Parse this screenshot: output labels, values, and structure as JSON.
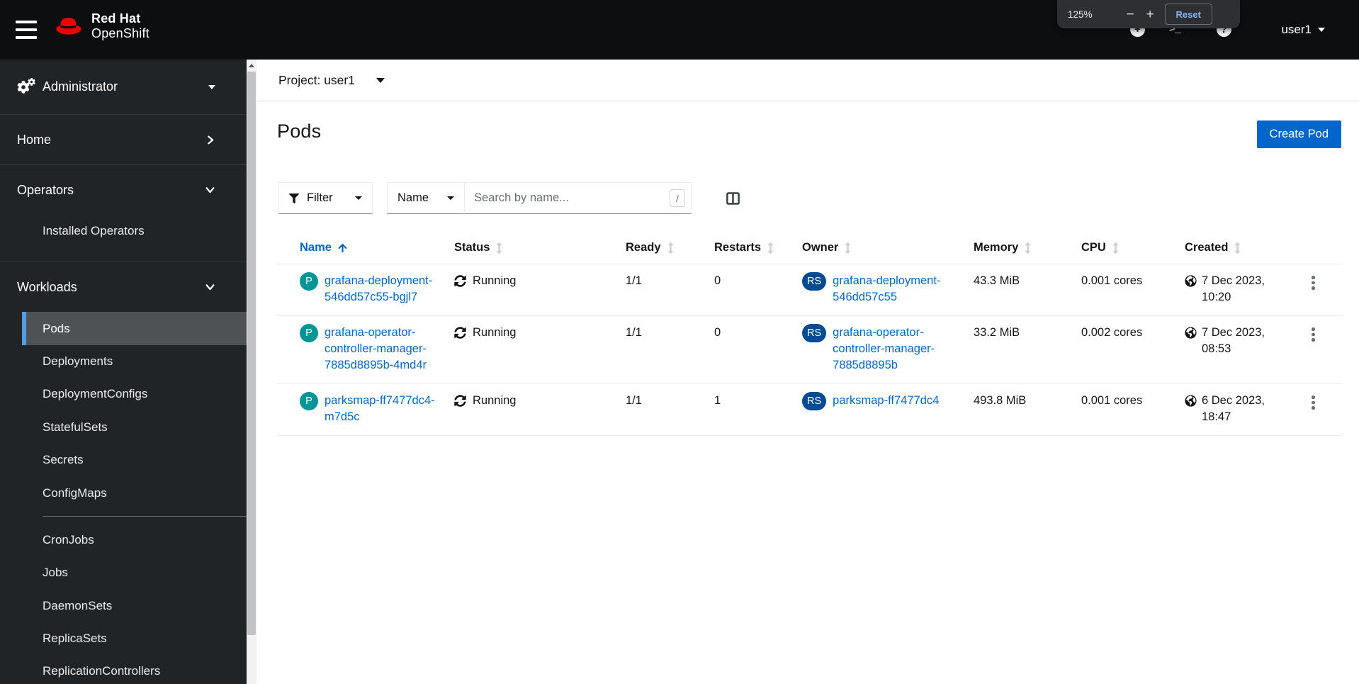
{
  "masthead": {
    "brand": {
      "line1": "Red Hat",
      "line2": "OpenShift"
    },
    "user": {
      "name": "user1"
    }
  },
  "browser_zoom_overlay": {
    "level": "125%",
    "minus_label": "−",
    "plus_label": "+",
    "reset_label": "Reset"
  },
  "sidebar": {
    "perspective": {
      "label": "Administrator"
    },
    "sections": [
      {
        "label": "Home",
        "state": "collapsed",
        "items": []
      },
      {
        "label": "Operators",
        "state": "expanded",
        "items": [
          {
            "label": "Installed Operators"
          }
        ]
      },
      {
        "label": "Workloads",
        "state": "expanded",
        "items": [
          {
            "label": "Pods",
            "active": true
          },
          {
            "label": "Deployments"
          },
          {
            "label": "DeploymentConfigs"
          },
          {
            "label": "StatefulSets"
          },
          {
            "label": "Secrets"
          },
          {
            "label": "ConfigMaps"
          },
          {
            "divider": true
          },
          {
            "label": "CronJobs"
          },
          {
            "label": "Jobs"
          },
          {
            "label": "DaemonSets"
          },
          {
            "label": "ReplicaSets"
          },
          {
            "label": "ReplicationControllers"
          }
        ]
      }
    ]
  },
  "project_bar": {
    "label": "Project: user1"
  },
  "page": {
    "title": "Pods",
    "create_button_label": "Create Pod"
  },
  "toolbar": {
    "filter": {
      "label": "Filter"
    },
    "attribute": {
      "label": "Name"
    },
    "search": {
      "placeholder": "Search by name...",
      "shortcut_hint": "/"
    }
  },
  "table": {
    "columns": [
      {
        "label": "Name",
        "sorted": "asc"
      },
      {
        "label": "Status",
        "sortable": true
      },
      {
        "label": "Ready",
        "sortable": true
      },
      {
        "label": "Restarts",
        "sortable": true
      },
      {
        "label": "Owner",
        "sortable": true
      },
      {
        "label": "Memory",
        "sortable": true
      },
      {
        "label": "CPU",
        "sortable": true
      },
      {
        "label": "Created",
        "sortable": true
      }
    ],
    "rows": [
      {
        "badge": "P",
        "name_lines": [
          "grafana-deployment-",
          "546dd57c55-bgjl7"
        ],
        "status": "Running",
        "ready": "1/1",
        "restarts": "0",
        "owner_badge": "RS",
        "owner_lines": [
          "grafana-deployment-",
          "546dd57c55"
        ],
        "memory": "43.3 MiB",
        "cpu": "0.001 cores",
        "created_date": "7 Dec 2023,",
        "created_time": "10:20"
      },
      {
        "badge": "P",
        "name_lines": [
          "grafana-operator-",
          "controller-manager-",
          "7885d8895b-4md4r"
        ],
        "status": "Running",
        "ready": "1/1",
        "restarts": "0",
        "owner_badge": "RS",
        "owner_lines": [
          "grafana-operator-",
          "controller-manager-",
          "7885d8895b"
        ],
        "memory": "33.2 MiB",
        "cpu": "0.002 cores",
        "created_date": "7 Dec 2023,",
        "created_time": "08:53"
      },
      {
        "badge": "P",
        "name_lines": [
          "parksmap-ff7477dc4-",
          "m7d5c"
        ],
        "status": "Running",
        "ready": "1/1",
        "restarts": "1",
        "owner_badge": "RS",
        "owner_lines": [
          "parksmap-ff7477dc4"
        ],
        "memory": "493.8 MiB",
        "cpu": "0.001 cores",
        "created_date": "6 Dec 2023,",
        "created_time": "18:47"
      }
    ]
  },
  "colors": {
    "primary": "#0066cc",
    "link": "#0066cc",
    "pod_badge": "#009596",
    "replicaset_badge": "#004b95",
    "nav_active_indicator": "#519de9",
    "masthead_bg": "#0d0e10",
    "sidebar_bg": "#212427",
    "reset_link": "#8ab4f8",
    "running_icon": "#151515"
  }
}
